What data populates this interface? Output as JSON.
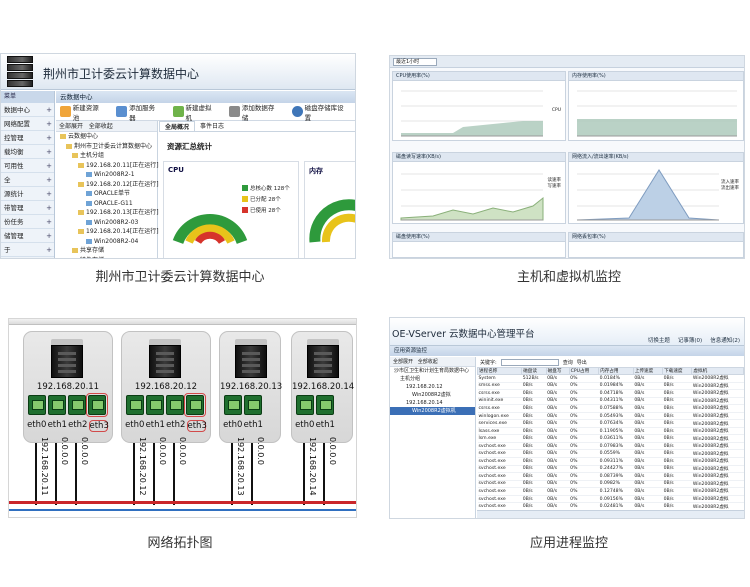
{
  "captions": {
    "datacenter": "荆州市卫计委云计算数据中心",
    "monitor": "主机和虚拟机监控",
    "topology": "网络拓扑图",
    "process": "应用进程监控"
  },
  "datacenter": {
    "title": "荆州市卫计委云计算数据中心",
    "left_header": "菜单",
    "left_items": [
      "数据中心",
      "网络配置",
      "控管理",
      "载均衡",
      "可用性",
      "全",
      "源统计",
      "带管理",
      "份任务",
      "储管理",
      "于"
    ],
    "main_header": "云数据中心",
    "toolbar": [
      "新建资源池",
      "添加服务器",
      "新建虚拟机",
      "添加数据存储",
      "磁盘存储库设置"
    ],
    "tree_bar": [
      "全部展开",
      "全部收起"
    ],
    "tree": [
      "云数据中心",
      "荆州市卫计委云计算数据中心",
      "主机分组",
      "192.168.20.11[正在运行]",
      "Win2008R2-1",
      "192.168.20.12[正在运行]",
      "ORACLE单节",
      "ORACLE-G11",
      "192.168.20.13[正在运行]",
      "Win2008R2-03",
      "192.168.20.14[正在运行]",
      "Win2008R2-04",
      "共享存储",
      "镜像存储",
      "全部数据"
    ],
    "tabs": [
      "全局概况",
      "事件日志"
    ],
    "summary_title": "资源汇总统计",
    "cpu_label": "CPU",
    "mem_label": "内存",
    "legend": [
      {
        "label": "总核心数 128个",
        "color": "#2e9a3c"
      },
      {
        "label": "已分配 28个",
        "color": "#e8c31a"
      },
      {
        "label": "已使用 28个",
        "color": "#d6332b"
      }
    ]
  },
  "monitor": {
    "select": "最近1小时",
    "charts": [
      {
        "title": "CPU使用率(%)",
        "legend": [
          "CPU"
        ]
      },
      {
        "title": "内存使用率(%)",
        "legend": []
      },
      {
        "title": "磁盘读写速率(KB/s)",
        "legend": [
          "读速率",
          "写速率"
        ]
      },
      {
        "title": "网络流入/流出速率(KB/s)",
        "legend": [
          "流入速率",
          "流出速率"
        ]
      },
      {
        "title": "磁盘使用率(%)",
        "legend": []
      },
      {
        "title": "网络丢包率(%)",
        "legend": []
      }
    ]
  },
  "topology": {
    "hosts": [
      {
        "ip": "192.168.20.11",
        "eths": [
          "eth0",
          "eth1",
          "eth2",
          "eth3"
        ],
        "highlight": 3,
        "links": [
          "192.168.20.11",
          "0.0.0.0",
          "0.0.0.0"
        ]
      },
      {
        "ip": "192.168.20.12",
        "eths": [
          "eth0",
          "eth1",
          "eth2",
          "eth3"
        ],
        "highlight": 3,
        "links": [
          "192.168.20.12",
          "0.0.0.0",
          "0.0.0.0"
        ]
      },
      {
        "ip": "192.168.20.13",
        "eths": [
          "eth0",
          "eth1"
        ],
        "highlight": -1,
        "links": [
          "192.168.20.13",
          "0.0.0.0"
        ]
      },
      {
        "ip": "192.168.20.14",
        "eths": [
          "eth0",
          "eth1"
        ],
        "highlight": -1,
        "links": [
          "192.168.20.14",
          "0.0.0.0"
        ]
      }
    ]
  },
  "process": {
    "title": "OE-VServer 云数据中心管理平台",
    "toplinks": [
      "切换主题",
      "记事簿(0)",
      "信息通知(2)"
    ],
    "sub": "应用资源监控",
    "tree_bar": [
      "全部展开",
      "全部收起"
    ],
    "tree": [
      "沙市区卫生和计划生育局数据中心",
      "主机分组",
      "192.168.20.12",
      "Win2008R2虚拟",
      "192.168.20.14",
      "Win2008R2虚拟机"
    ],
    "filter_label": "关键字:",
    "filter_buttons": [
      "查询",
      "导出"
    ],
    "columns": [
      "进程名称",
      "磁盘读",
      "磁盘写",
      "CPU占用",
      "内存占用",
      "上传速度",
      "下载速度",
      "虚拟机"
    ],
    "rows": [
      [
        "System",
        "512B/s",
        "0B/s",
        "0%",
        "0.0184%",
        "0B/s",
        "0B/s",
        "Win2008R2虚拟"
      ],
      [
        "smss.exe",
        "0B/s",
        "0B/s",
        "0%",
        "0.01984%",
        "0B/s",
        "0B/s",
        "Win2008R2虚拟"
      ],
      [
        "csrss.exe",
        "0B/s",
        "0B/s",
        "0%",
        "0.04718%",
        "0B/s",
        "0B/s",
        "Win2008R2虚拟"
      ],
      [
        "wininit.exe",
        "0B/s",
        "0B/s",
        "0%",
        "0.04311%",
        "0B/s",
        "0B/s",
        "Win2008R2虚拟"
      ],
      [
        "csrss.exe",
        "0B/s",
        "0B/s",
        "0%",
        "0.07588%",
        "0B/s",
        "0B/s",
        "Win2008R2虚拟"
      ],
      [
        "winlogon.exe",
        "0B/s",
        "0B/s",
        "0%",
        "0.05493%",
        "0B/s",
        "0B/s",
        "Win2008R2虚拟"
      ],
      [
        "services.exe",
        "0B/s",
        "0B/s",
        "0%",
        "0.07634%",
        "0B/s",
        "0B/s",
        "Win2008R2虚拟"
      ],
      [
        "lsass.exe",
        "0B/s",
        "0B/s",
        "0%",
        "0.11905%",
        "0B/s",
        "0B/s",
        "Win2008R2虚拟"
      ],
      [
        "lsm.exe",
        "0B/s",
        "0B/s",
        "0%",
        "0.03611%",
        "0B/s",
        "0B/s",
        "Win2008R2虚拟"
      ],
      [
        "svchost.exe",
        "0B/s",
        "0B/s",
        "0%",
        "0.07983%",
        "0B/s",
        "0B/s",
        "Win2008R2虚拟"
      ],
      [
        "svchost.exe",
        "0B/s",
        "0B/s",
        "0%",
        "0.0559%",
        "0B/s",
        "0B/s",
        "Win2008R2虚拟"
      ],
      [
        "svchost.exe",
        "0B/s",
        "0B/s",
        "0%",
        "0.09311%",
        "0B/s",
        "0B/s",
        "Win2008R2虚拟"
      ],
      [
        "svchost.exe",
        "0B/s",
        "0B/s",
        "0%",
        "0.24427%",
        "0B/s",
        "0B/s",
        "Win2008R2虚拟"
      ],
      [
        "svchost.exe",
        "0B/s",
        "0B/s",
        "0%",
        "0.08739%",
        "0B/s",
        "0B/s",
        "Win2008R2虚拟"
      ],
      [
        "svchost.exe",
        "0B/s",
        "0B/s",
        "0%",
        "0.0982%",
        "0B/s",
        "0B/s",
        "Win2008R2虚拟"
      ],
      [
        "svchost.exe",
        "0B/s",
        "0B/s",
        "0%",
        "0.12748%",
        "0B/s",
        "0B/s",
        "Win2008R2虚拟"
      ],
      [
        "svchost.exe",
        "0B/s",
        "0B/s",
        "0%",
        "0.09156%",
        "0B/s",
        "0B/s",
        "Win2008R2虚拟"
      ],
      [
        "svchost.exe",
        "0B/s",
        "0B/s",
        "0%",
        "0.02481%",
        "0B/s",
        "0B/s",
        "Win2008R2虚拟"
      ]
    ]
  },
  "colors": {
    "green": "#2e9a3c",
    "yellow": "#e8c31a",
    "red": "#d6332b",
    "chart_fill": "#a9c7b8"
  }
}
